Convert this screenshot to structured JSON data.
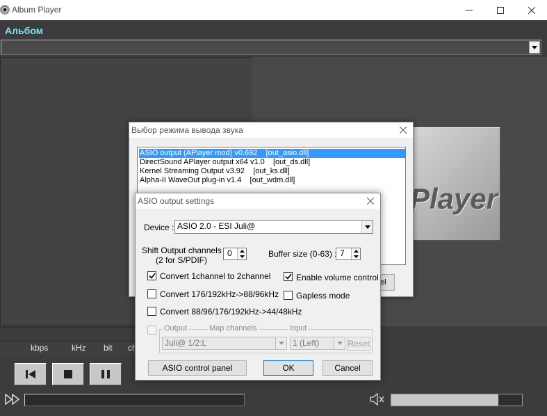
{
  "window": {
    "title": "Album Player"
  },
  "album": {
    "label": "Альбом",
    "value": ""
  },
  "status": {
    "kbps": "kbps",
    "khz": "kHz",
    "bit": "bit",
    "ch": "ch"
  },
  "transport": [
    "previous",
    "stop",
    "pause"
  ],
  "volume": {
    "level": 0.82
  },
  "logo": {
    "text": "Player"
  },
  "output_dialog": {
    "title": "Выбор режима вывода звука",
    "items": [
      "ASIO output (APlayer mod) v0.692    [out_asio.dll]",
      "DirectSound APlayer output x64 v1.0    [out_ds.dll]",
      "Kernel Streaming Output v3.92    [out_ks.dll]",
      "Alpha-II WaveOut plug-in v1.4    [out_wdm.dll]"
    ],
    "selected_index": 0,
    "partial_button": "el"
  },
  "asio_dialog": {
    "title": "ASIO output settings",
    "device_label": "Device :",
    "device_value": "ASIO 2.0 - ESI Juli@",
    "shift_label": "Shift Output channels :",
    "shift_sub": "(2 for S/PDIF)",
    "shift_value": "0",
    "buffer_label": "Buffer size (0-63) :",
    "buffer_value": "7",
    "convert_1to2": "Convert 1channel to 2channel",
    "convert_176": "Convert 176/192kHz->88/96kHz",
    "convert_88": "Convert 88/96/176/192kHz->44/48kHz",
    "enable_volume": "Enable volume control",
    "gapless": "Gapless mode",
    "map_output": "Output",
    "map_channels": "Map channels",
    "map_input": "Input",
    "map_output_value": "Juli@ 1/2:L",
    "map_input_value": "1 (Left)",
    "reset": "Reset",
    "control_panel": "ASIO control panel",
    "ok": "OK",
    "cancel": "Cancel"
  }
}
